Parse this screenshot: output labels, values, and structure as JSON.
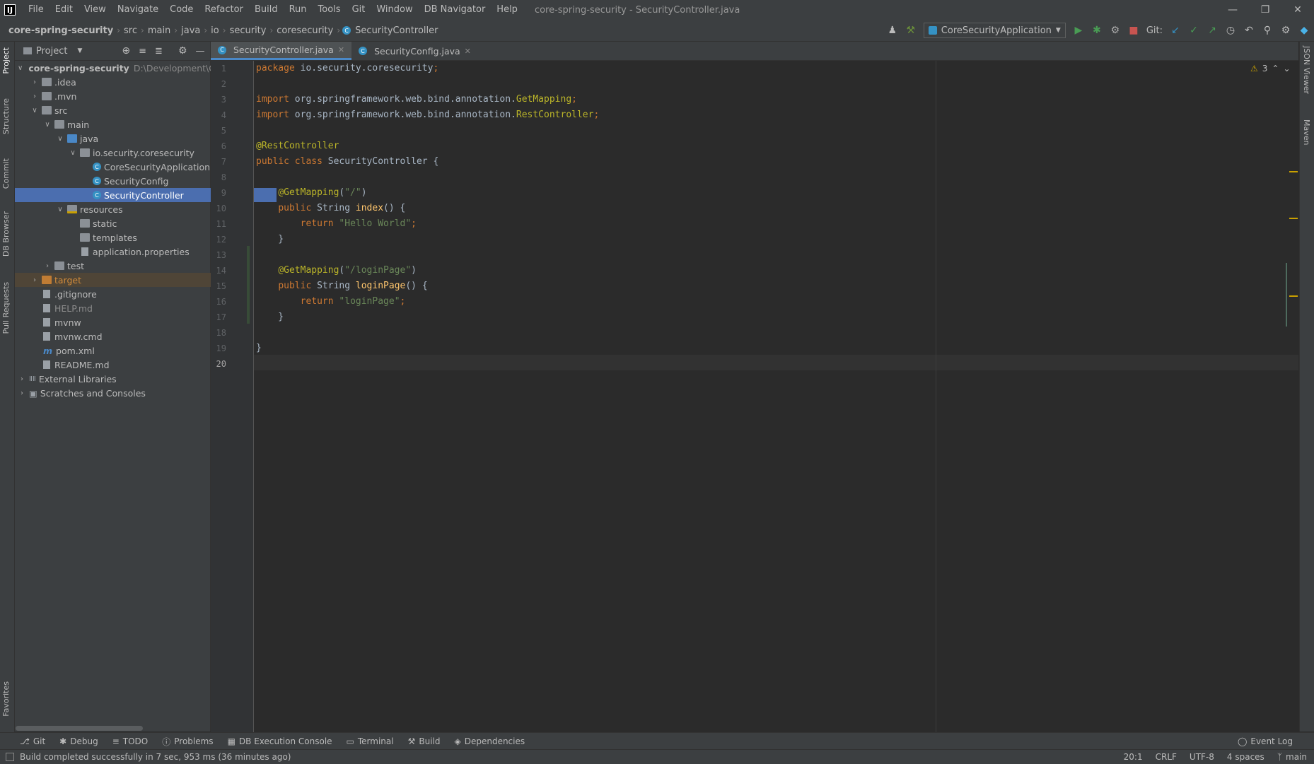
{
  "menu": {
    "items": [
      "File",
      "Edit",
      "View",
      "Navigate",
      "Code",
      "Refactor",
      "Build",
      "Run",
      "Tools",
      "Git",
      "Window",
      "DB Navigator",
      "Help"
    ],
    "window_title": "core-spring-security - SecurityController.java"
  },
  "breadcrumb": [
    "core-spring-security",
    "src",
    "main",
    "java",
    "io",
    "security",
    "coresecurity",
    "SecurityController"
  ],
  "toolbar": {
    "run_config": "CoreSecurityApplication",
    "git_label": "Git:"
  },
  "left_strip": [
    "Project",
    "Structure",
    "Commit",
    "DB Browser",
    "Pull Requests",
    "Favorites"
  ],
  "right_strip": [
    "JSON Viewer",
    "Maven"
  ],
  "project_panel": {
    "title": "Project",
    "tree": [
      {
        "label": "core-spring-security",
        "extra": "D:\\Development\\G",
        "depth": 0,
        "arrow": "open",
        "kind": "module"
      },
      {
        "label": ".idea",
        "depth": 1,
        "arrow": "closed",
        "kind": "folder"
      },
      {
        "label": ".mvn",
        "depth": 1,
        "arrow": "closed",
        "kind": "folder"
      },
      {
        "label": "src",
        "depth": 1,
        "arrow": "open",
        "kind": "folder"
      },
      {
        "label": "main",
        "depth": 2,
        "arrow": "open",
        "kind": "folder"
      },
      {
        "label": "java",
        "depth": 3,
        "arrow": "open",
        "kind": "src"
      },
      {
        "label": "io.security.coresecurity",
        "depth": 4,
        "arrow": "open",
        "kind": "package"
      },
      {
        "label": "CoreSecurityApplication",
        "depth": 5,
        "arrow": "none",
        "kind": "class"
      },
      {
        "label": "SecurityConfig",
        "depth": 5,
        "arrow": "none",
        "kind": "class"
      },
      {
        "label": "SecurityController",
        "depth": 5,
        "arrow": "none",
        "kind": "class",
        "selected": true
      },
      {
        "label": "resources",
        "depth": 3,
        "arrow": "open",
        "kind": "res"
      },
      {
        "label": "static",
        "depth": 4,
        "arrow": "none",
        "kind": "folder"
      },
      {
        "label": "templates",
        "depth": 4,
        "arrow": "none",
        "kind": "folder"
      },
      {
        "label": "application.properties",
        "depth": 4,
        "arrow": "none",
        "kind": "file"
      },
      {
        "label": "test",
        "depth": 2,
        "arrow": "closed",
        "kind": "folder"
      },
      {
        "label": "target",
        "depth": 1,
        "arrow": "closed",
        "kind": "orange",
        "excluded": true
      },
      {
        "label": ".gitignore",
        "depth": 1,
        "arrow": "none",
        "kind": "file"
      },
      {
        "label": "HELP.md",
        "depth": 1,
        "arrow": "none",
        "kind": "file"
      },
      {
        "label": "mvnw",
        "depth": 1,
        "arrow": "none",
        "kind": "file"
      },
      {
        "label": "mvnw.cmd",
        "depth": 1,
        "arrow": "none",
        "kind": "file"
      },
      {
        "label": "pom.xml",
        "depth": 1,
        "arrow": "none",
        "kind": "maven"
      },
      {
        "label": "README.md",
        "depth": 1,
        "arrow": "none",
        "kind": "file"
      },
      {
        "label": "External Libraries",
        "depth": 0,
        "arrow": "closed",
        "kind": "lib"
      },
      {
        "label": "Scratches and Consoles",
        "depth": 0,
        "arrow": "closed",
        "kind": "scratch"
      }
    ]
  },
  "editor": {
    "tabs": [
      {
        "label": "SecurityController.java",
        "active": true
      },
      {
        "label": "SecurityConfig.java",
        "active": false
      }
    ],
    "warning_count": "3",
    "lines": [
      [
        [
          "kw",
          "package "
        ],
        [
          "cls",
          "io.security.coresecurity"
        ],
        [
          "kw",
          ";"
        ]
      ],
      [],
      [
        [
          "kw",
          "import "
        ],
        [
          "cls",
          "org.springframework.web.bind.annotation."
        ],
        [
          "an",
          "GetMapping"
        ],
        [
          "kw",
          ";"
        ]
      ],
      [
        [
          "kw",
          "import "
        ],
        [
          "cls",
          "org.springframework.web.bind.annotation."
        ],
        [
          "an",
          "RestController"
        ],
        [
          "kw",
          ";"
        ]
      ],
      [],
      [
        [
          "an",
          "@RestController"
        ]
      ],
      [
        [
          "kw",
          "public class "
        ],
        [
          "cls",
          "SecurityController {"
        ]
      ],
      [],
      [
        [
          "cls",
          "    "
        ],
        [
          "an",
          "@GetMapping"
        ],
        [
          "cls",
          "("
        ],
        [
          "st",
          "\"/\""
        ],
        [
          "cls",
          ")"
        ]
      ],
      [
        [
          "cls",
          "    "
        ],
        [
          "kw",
          "public "
        ],
        [
          "cls",
          "String "
        ],
        [
          "fn",
          "index"
        ],
        [
          "cls",
          "() {"
        ]
      ],
      [
        [
          "cls",
          "        "
        ],
        [
          "kw",
          "return "
        ],
        [
          "st",
          "\"Hello World\""
        ],
        [
          "kw",
          ";"
        ]
      ],
      [
        [
          "cls",
          "    }"
        ]
      ],
      [],
      [
        [
          "cls",
          "    "
        ],
        [
          "an",
          "@GetMapping"
        ],
        [
          "cls",
          "("
        ],
        [
          "st",
          "\"/loginPage\""
        ],
        [
          "cls",
          ")"
        ]
      ],
      [
        [
          "cls",
          "    "
        ],
        [
          "kw",
          "public "
        ],
        [
          "cls",
          "String "
        ],
        [
          "fn",
          "loginPage"
        ],
        [
          "cls",
          "() {"
        ]
      ],
      [
        [
          "cls",
          "        "
        ],
        [
          "kw",
          "return "
        ],
        [
          "st",
          "\"loginPage\""
        ],
        [
          "kw",
          ";"
        ]
      ],
      [
        [
          "cls",
          "    }"
        ]
      ],
      [],
      [
        [
          "cls",
          "}"
        ]
      ],
      []
    ]
  },
  "bottom_tools": [
    "Git",
    "Debug",
    "TODO",
    "Problems",
    "DB Execution Console",
    "Terminal",
    "Build",
    "Dependencies"
  ],
  "event_log": "Event Log",
  "status": {
    "message": "Build completed successfully in 7 sec, 953 ms (36 minutes ago)",
    "position": "20:1",
    "line_sep": "CRLF",
    "encoding": "UTF-8",
    "indent": "4 spaces",
    "branch": "main"
  }
}
